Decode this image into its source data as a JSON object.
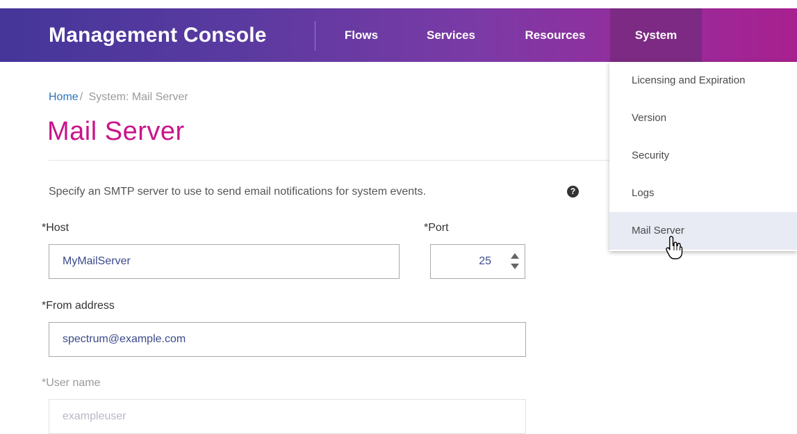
{
  "header": {
    "brand": "Management Console",
    "nav": {
      "flows": "Flows",
      "services": "Services",
      "resources": "Resources",
      "system": "System"
    },
    "colors": {
      "gradient_start": "#45369a",
      "gradient_end": "#a8208f",
      "active_tab": "#7c2a83"
    }
  },
  "system_menu": {
    "items": [
      {
        "label": "Licensing and Expiration"
      },
      {
        "label": "Version"
      },
      {
        "label": "Security"
      },
      {
        "label": "Logs"
      },
      {
        "label": "Mail Server",
        "active": true
      }
    ]
  },
  "breadcrumb": {
    "home": "Home",
    "separator": "/",
    "current": "System: Mail Server"
  },
  "page": {
    "title": "Mail Server",
    "title_color": "#c8158a",
    "description": "Specify an SMTP server to use to send email notifications for system events.",
    "help_icon": "?"
  },
  "form": {
    "host": {
      "label": "*Host",
      "value": "MyMailServer"
    },
    "port": {
      "label": "*Port",
      "value": "25"
    },
    "from_address": {
      "label": "*From address",
      "value": "spectrum@example.com"
    },
    "user_name": {
      "label": "*User name",
      "placeholder": "exampleuser",
      "disabled": true
    }
  }
}
